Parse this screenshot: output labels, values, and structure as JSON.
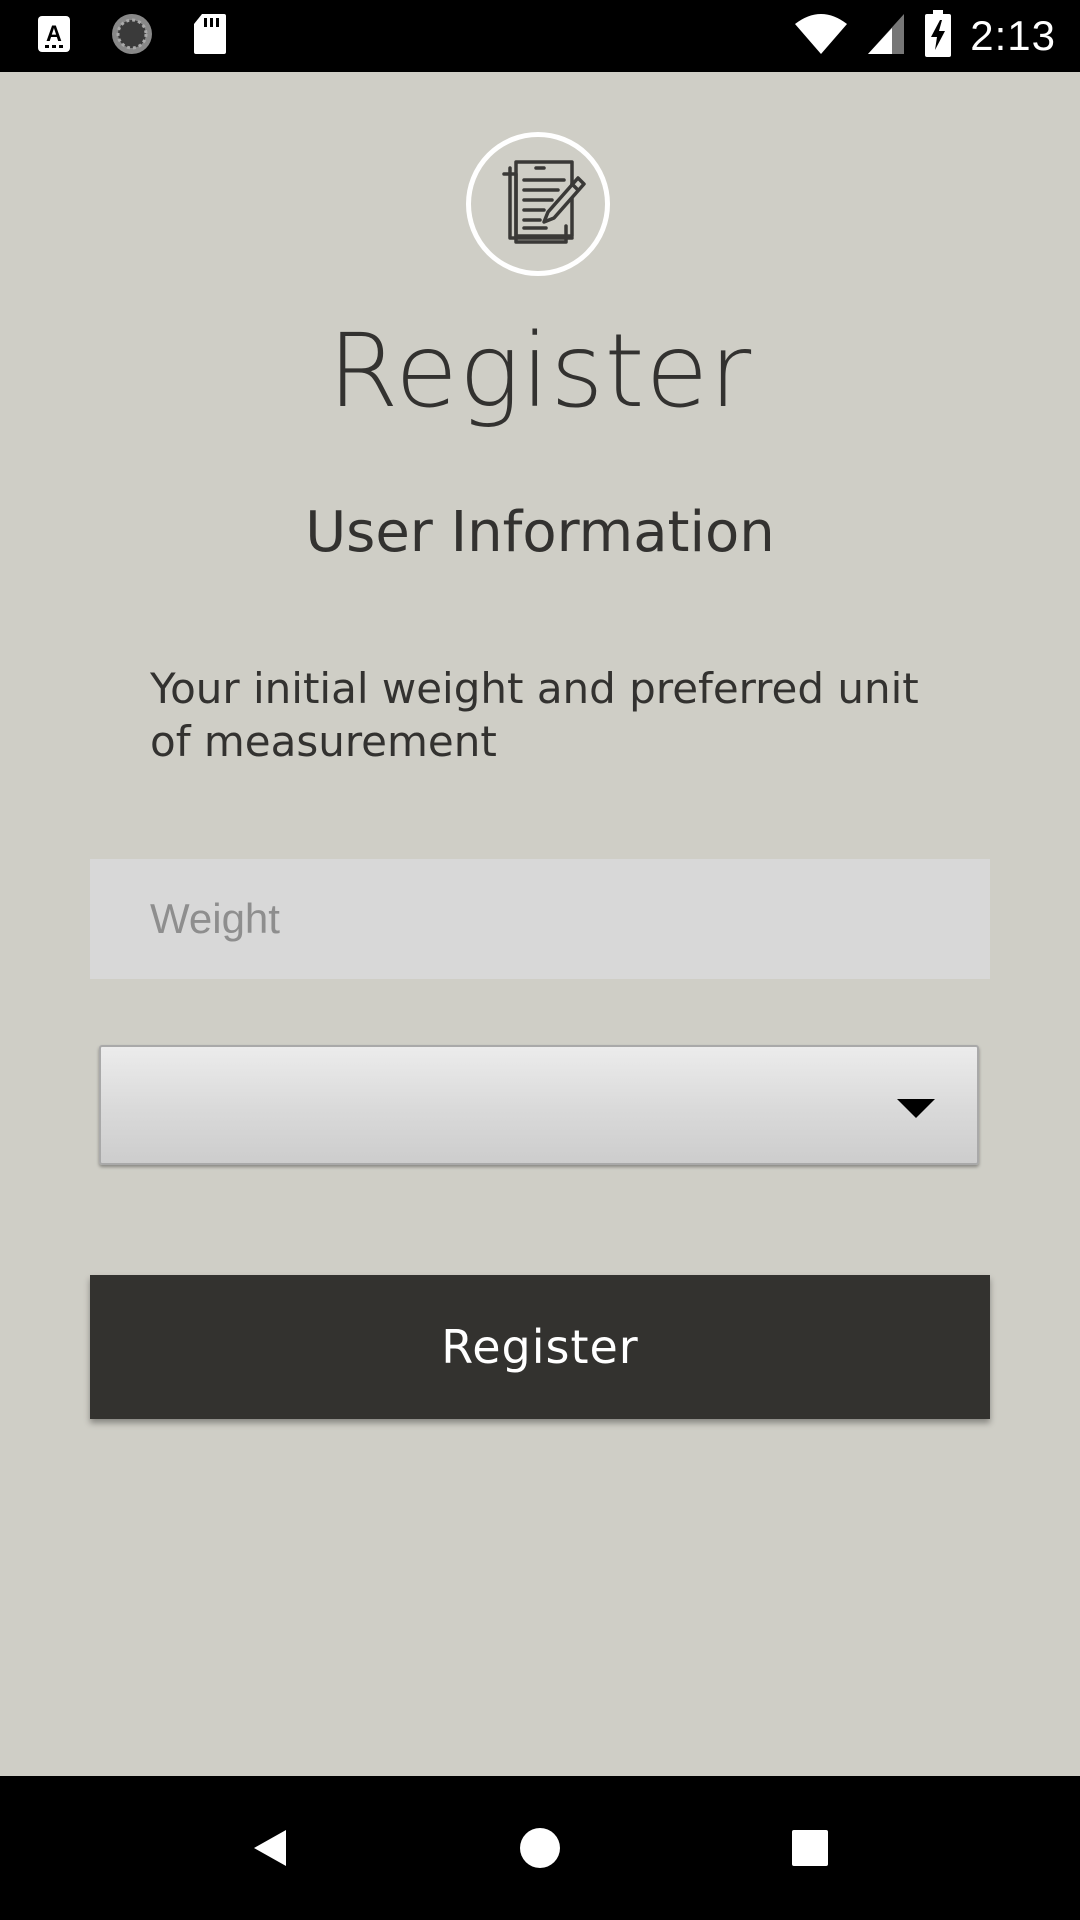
{
  "status_bar": {
    "time": "2:13",
    "left_icons": [
      "a-icon",
      "sync-icon",
      "sd-card-icon"
    ],
    "right_icons": [
      "wifi-icon",
      "signal-icon",
      "battery-charging-icon"
    ]
  },
  "header": {
    "logo_icon": "notepad-pencil-icon",
    "title": "Register",
    "subtitle": "User Information"
  },
  "form": {
    "description": "Your initial weight and preferred unit of measurement",
    "weight_placeholder": "Weight",
    "weight_value": "",
    "unit_selected": "",
    "submit_label": "Register"
  },
  "nav_bar": {
    "buttons": [
      "back-icon",
      "home-icon",
      "recents-icon"
    ]
  },
  "colors": {
    "background": "#cfcec6",
    "text": "#333230",
    "button": "#33322f",
    "input_background": "#d8d8d8"
  }
}
